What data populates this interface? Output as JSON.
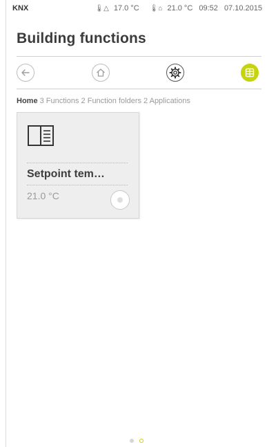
{
  "colors": {
    "accent": "#c6d40f",
    "text": "#333333",
    "muted": "#9a9a9a"
  },
  "status": {
    "brand": "KNX",
    "outdoor_temp": "17.0 °C",
    "indoor_temp": "21.0 °C",
    "time": "09:52",
    "date": "07.10.2015"
  },
  "page": {
    "title": "Building functions"
  },
  "nav": {
    "back_icon": "arrow-left-icon",
    "home_icon": "home-icon",
    "settings_icon": "gear-icon",
    "grid_icon": "grid-icon",
    "active": "grid"
  },
  "breadcrumb": {
    "home": "Home",
    "rest": "3 Functions 2 Function folders 2 Applications"
  },
  "tiles": [
    {
      "icon": "book-icon",
      "title": "Setpoint tem…",
      "value": "21.0 °C"
    }
  ],
  "pager": {
    "pages": 2,
    "current": 1
  }
}
